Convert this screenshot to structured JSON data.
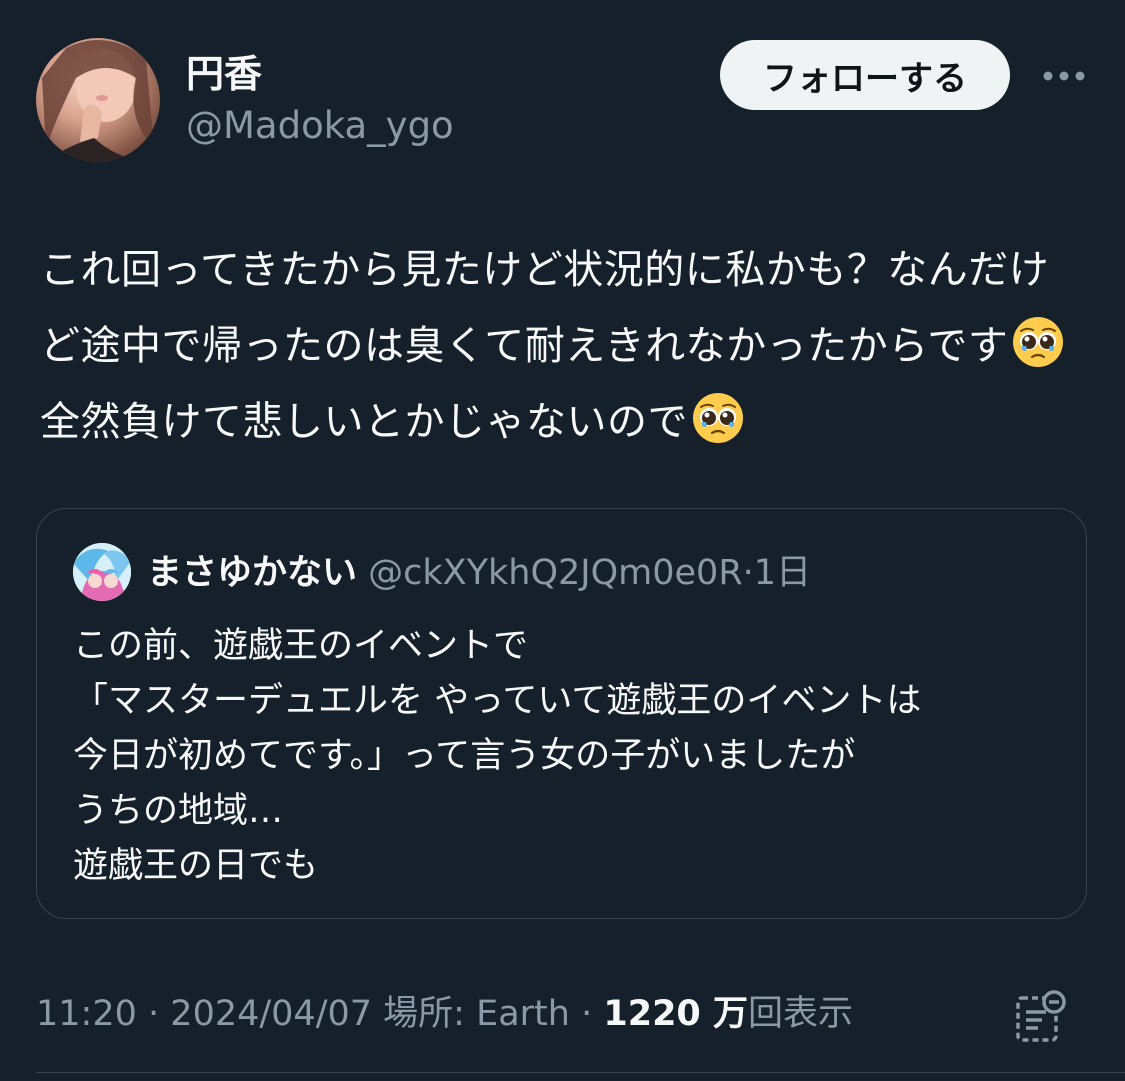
{
  "author": {
    "display_name": "円香",
    "handle": "@Madoka_ygo"
  },
  "follow_button_label": "フォローする",
  "more_icon": "more-horizontal-icon",
  "tweet": {
    "text_parts": [
      "これ回ってきたから見たけど状況的に私かも？なんだけど途中で帰ったのは臭くて耐えきれなかったからです",
      "全然負けて悲しいとかじゃないので"
    ],
    "emoji": "pleading-face-with-tears"
  },
  "quote": {
    "display_name": "まさゆかない",
    "handle": "@ckXYkhQ2JQm0e0R",
    "separator": "·",
    "time": "1日",
    "lines": [
      "この前、遊戯王のイベントで",
      "「マスターデュエルを やっていて遊戯王のイベントは",
      "今日が初めてです。」って言う女の子がいましたが",
      "うちの地域…",
      "遊戯王の日でも"
    ]
  },
  "meta": {
    "time": "11:20",
    "sep1": "·",
    "date": "2024/04/07",
    "location": "場所: Earth",
    "sep2": "·",
    "views_count": "1220 万",
    "views_label": "回表示"
  },
  "colors": {
    "background": "#15202b",
    "text_primary": "#f7f9f9",
    "text_secondary": "#8b98a5",
    "border": "#38444d",
    "follow_bg": "#eff3f4"
  }
}
